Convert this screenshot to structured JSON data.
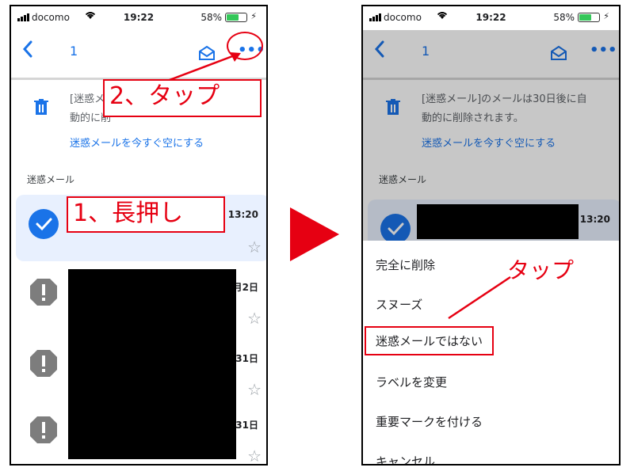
{
  "left_phone": {
    "status": {
      "carrier": "docomo",
      "time": "19:22",
      "battery": "58%",
      "battery_level": 0.58
    },
    "toolbar": {
      "back_icon": "chevron-left-icon",
      "count": "1",
      "mail_icon": "envelope-open-icon",
      "more_icon": "more-horizontal-icon",
      "more_label": "•••"
    },
    "notice": {
      "text_line1": "[迷惑メ",
      "text_line2": "動的に削",
      "link": "迷惑メールを今すぐ空にする"
    },
    "section_label": "迷惑メール",
    "rows": [
      {
        "time": "13:20",
        "state": "selected"
      },
      {
        "time": "月2日"
      },
      {
        "time": "31日"
      },
      {
        "time": "31日"
      }
    ],
    "star_glyph": "☆",
    "check_glyph": "✓",
    "callouts": {
      "step1": "1、長押し",
      "step2": "2、タップ"
    }
  },
  "right_phone": {
    "status": {
      "carrier": "docomo",
      "time": "19:22",
      "battery": "58%",
      "battery_level": 0.58
    },
    "toolbar": {
      "count": "1",
      "more_label": "•••"
    },
    "notice": {
      "text_line1": "[迷惑メール]のメールは30日後に自",
      "text_line2": "動的に削除されます。",
      "link": "迷惑メールを今すぐ空にする"
    },
    "section_label": "迷惑メール",
    "row_time": "13:20",
    "menu": [
      "完全に削除",
      "スヌーズ",
      "迷惑メールではない",
      "ラベルを変更",
      "重要マークを付ける",
      "キャンセル"
    ],
    "callout": "タップ"
  },
  "colors": {
    "accent": "#1a73e8",
    "annotation_red": "#e60012",
    "selected_bg": "#e8f0fe"
  }
}
